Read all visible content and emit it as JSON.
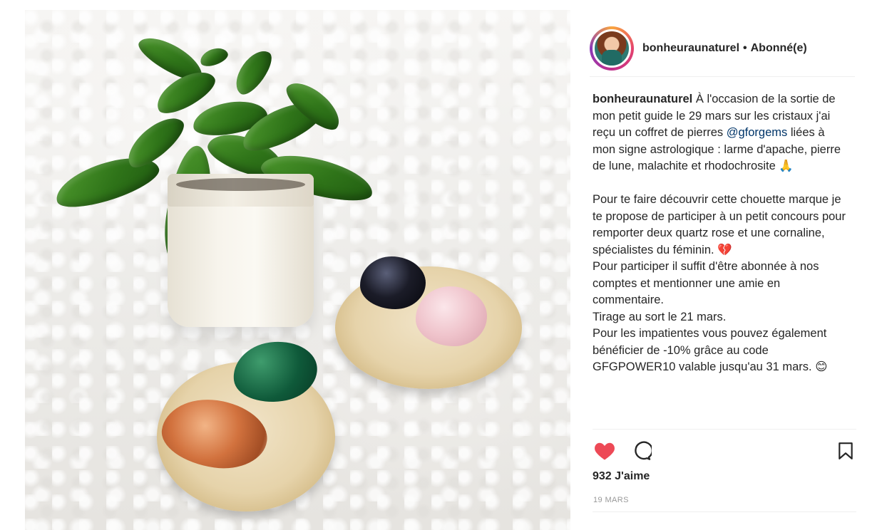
{
  "post": {
    "username": "bonheuraunaturel",
    "separator": "•",
    "follow_status": "Abonné(e)",
    "image_icon": "post-photo"
  },
  "caption": {
    "username": "bonheuraunaturel",
    "line1_a": " À l'occasion de la sortie de mon petit guide le 29 mars sur les cristaux j'ai reçu un coffret de pierres ",
    "mention": "@gforgems",
    "line1_b": " liées à mon signe astrologique : larme d'apache, pierre de lune, malachite et rhodochrosite 🙏",
    "paragraph2": "Pour te faire découvrir cette chouette marque je te propose de participer à un petit concours pour remporter deux quartz rose et une cornaline, spécialistes du féminin. 💔\nPour participer il suffit d'être abonnée à nos comptes et mentionner une amie en commentaire.\nTirage au sort le 21 mars.\nPour les impatientes vous pouvez également bénéficier de -10% grâce au code GFGPOWER10 valable jusqu'au 31 mars. 😊"
  },
  "actions": {
    "like_icon": "heart-filled-icon",
    "comment_icon": "comment-bubble-icon",
    "save_icon": "bookmark-icon",
    "like_color": "#ed4956"
  },
  "stats": {
    "likes": "932 J'aime",
    "date": "19 MARS"
  }
}
